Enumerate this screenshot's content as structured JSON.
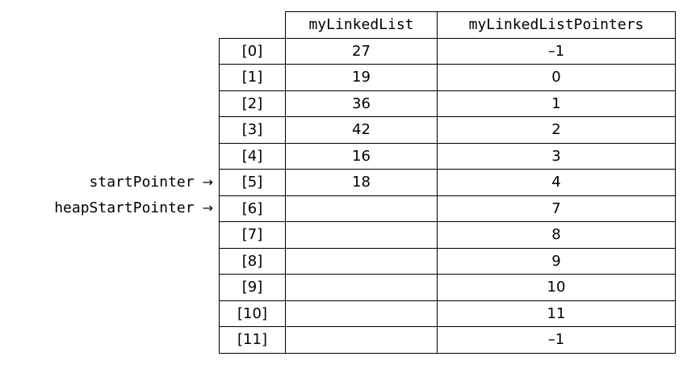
{
  "table": {
    "headers": [
      "myLinkedList",
      "myLinkedListPointers"
    ],
    "rows": [
      {
        "index": "[0]",
        "value": "27",
        "pointer": "–1"
      },
      {
        "index": "[1]",
        "value": "19",
        "pointer": "0"
      },
      {
        "index": "[2]",
        "value": "36",
        "pointer": "1"
      },
      {
        "index": "[3]",
        "value": "42",
        "pointer": "2"
      },
      {
        "index": "[4]",
        "value": "16",
        "pointer": "3"
      },
      {
        "index": "[5]",
        "value": "18",
        "pointer": "4"
      },
      {
        "index": "[6]",
        "value": "",
        "pointer": "7"
      },
      {
        "index": "[7]",
        "value": "",
        "pointer": "8"
      },
      {
        "index": "[8]",
        "value": "",
        "pointer": "9"
      },
      {
        "index": "[9]",
        "value": "",
        "pointer": "10"
      },
      {
        "index": "[10]",
        "value": "",
        "pointer": "11"
      },
      {
        "index": "[11]",
        "value": "",
        "pointer": "–1"
      }
    ]
  },
  "pointers": [
    {
      "label": "startPointer",
      "arrow": "→",
      "target_index": 5
    },
    {
      "label": "heapStartPointer",
      "arrow": "→",
      "target_index": 6
    }
  ]
}
